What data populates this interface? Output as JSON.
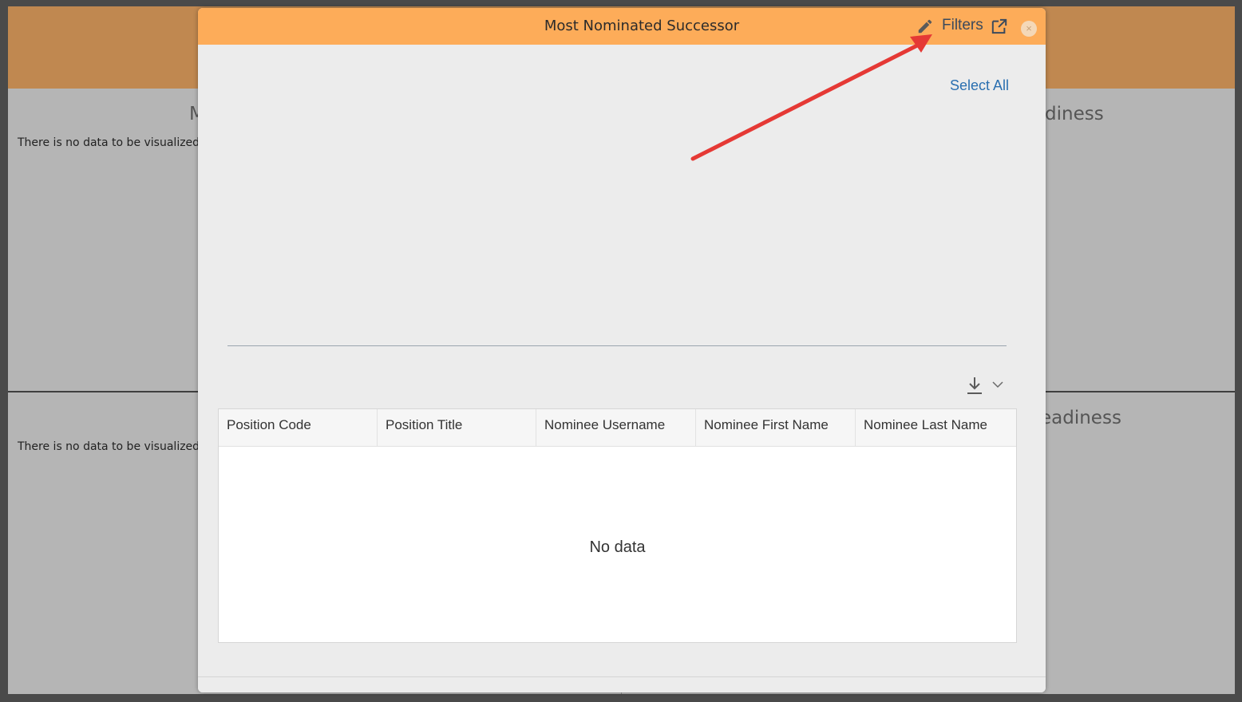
{
  "dashboard": {
    "tiles": [
      {
        "title": "M",
        "message": "There is no data to be visualized."
      },
      {
        "title": "diness"
      },
      {
        "message": "There is no data to be visualized."
      },
      {
        "title": "eadiness"
      }
    ]
  },
  "modal": {
    "title": "Most Nominated Successor",
    "filters_label": "Filters",
    "close_symbol": "×",
    "select_all_label": "Select All",
    "icons": {
      "edit": "pencil-icon",
      "open_external": "external-link-icon",
      "close": "close-icon",
      "download": "download-icon",
      "dropdown": "chevron-down-icon"
    },
    "table": {
      "columns": [
        "Position Code",
        "Position Title",
        "Nominee Username",
        "Nominee First Name",
        "Nominee Last Name"
      ],
      "empty_message": "No data"
    }
  },
  "colors": {
    "modal_header": "#fdac59",
    "dashboard_header": "#c08850",
    "link": "#2a6fb0",
    "annotation_arrow": "#e53935"
  }
}
